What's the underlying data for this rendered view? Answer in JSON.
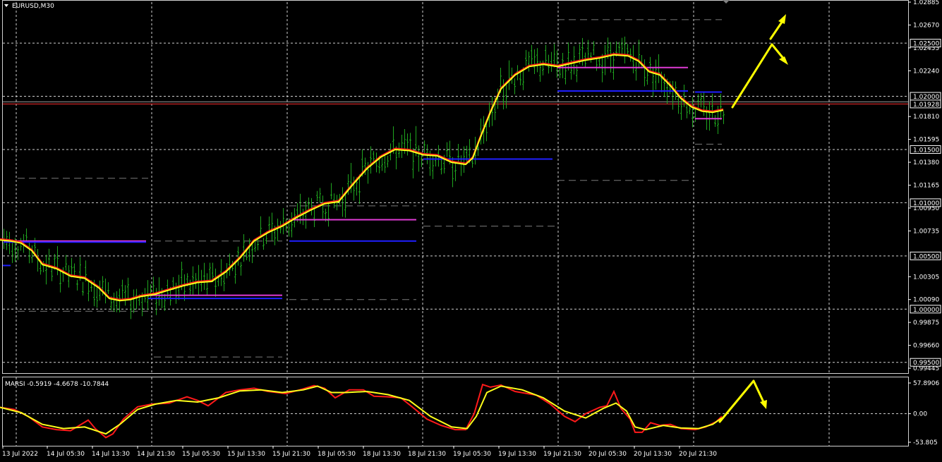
{
  "window": {
    "symbol_title": "EURUSD,M30",
    "indicator_title": "MARSI -0.5919 -4.6678 -10.7844"
  },
  "colors": {
    "background": "#000000",
    "grid": "#cfcfcf",
    "candles": "#1fa51f",
    "ma_red": "#ff1a1a",
    "ma_yellow": "#ffff1a",
    "level_magenta": "#e03bd6",
    "level_blue": "#1f1fff",
    "level_dashed": "#7a7a7a",
    "arrow": "#ffff00",
    "price_line": "#ff3030"
  },
  "chart_data": [
    {
      "type": "candlestick",
      "title": "EURUSD,M30",
      "ylim": [
        0.99445,
        1.02885
      ],
      "y_tick_labels": [
        "1.02885",
        "1.02670",
        "1.02455",
        "1.02240",
        "1.01810",
        "1.01595",
        "1.01380",
        "1.01165",
        "1.00950",
        "1.00735",
        "1.00305",
        "1.00090",
        "0.99875",
        "0.99660",
        "0.99445"
      ],
      "highlighted_levels": [
        "1.02500",
        "1.02000",
        "1.01928",
        "1.01500",
        "1.01000",
        "1.00500",
        "1.00000",
        "0.99500"
      ],
      "current_price": "1.01928",
      "x_tick_labels": [
        "13 Jul 2022",
        "14 Jul 05:30",
        "14 Jul 13:30",
        "14 Jul 21:30",
        "15 Jul 05:30",
        "15 Jul 13:30",
        "15 Jul 21:30",
        "18 Jul 05:30",
        "18 Jul 13:30",
        "18 Jul 21:30",
        "19 Jul 05:30",
        "19 Jul 13:30",
        "19 Jul 21:30",
        "20 Jul 05:30",
        "20 Jul 13:30",
        "20 Jul 21:30"
      ],
      "price_path": [
        [
          0,
          1.0065
        ],
        [
          15,
          1.0064
        ],
        [
          30,
          1.0062
        ],
        [
          45,
          1.0055
        ],
        [
          60,
          1.0042
        ],
        [
          80,
          1.0038
        ],
        [
          100,
          1.0031
        ],
        [
          120,
          1.0029
        ],
        [
          140,
          1.002
        ],
        [
          155,
          1.001
        ],
        [
          170,
          1.0008
        ],
        [
          185,
          1.0009
        ],
        [
          200,
          1.0012
        ],
        [
          220,
          1.0014
        ],
        [
          240,
          1.0018
        ],
        [
          260,
          1.0022
        ],
        [
          280,
          1.0025
        ],
        [
          300,
          1.0026
        ],
        [
          320,
          1.0035
        ],
        [
          340,
          1.0048
        ],
        [
          360,
          1.0064
        ],
        [
          380,
          1.0072
        ],
        [
          400,
          1.0078
        ],
        [
          420,
          1.0086
        ],
        [
          440,
          1.0093
        ],
        [
          460,
          1.0099
        ],
        [
          480,
          1.0101
        ],
        [
          500,
          1.0117
        ],
        [
          520,
          1.0132
        ],
        [
          540,
          1.0143
        ],
        [
          560,
          1.015
        ],
        [
          580,
          1.0149
        ],
        [
          600,
          1.0145
        ],
        [
          620,
          1.0144
        ],
        [
          640,
          1.0138
        ],
        [
          660,
          1.0136
        ],
        [
          670,
          1.0142
        ],
        [
          680,
          1.016
        ],
        [
          695,
          1.0185
        ],
        [
          710,
          1.0207
        ],
        [
          730,
          1.022
        ],
        [
          750,
          1.0228
        ],
        [
          770,
          1.023
        ],
        [
          790,
          1.0228
        ],
        [
          810,
          1.0231
        ],
        [
          830,
          1.0234
        ],
        [
          850,
          1.0236
        ],
        [
          870,
          1.0239
        ],
        [
          890,
          1.0238
        ],
        [
          905,
          1.0233
        ],
        [
          920,
          1.0223
        ],
        [
          935,
          1.022
        ],
        [
          950,
          1.021
        ],
        [
          965,
          1.0198
        ],
        [
          980,
          1.019
        ],
        [
          995,
          1.0186
        ],
        [
          1010,
          1.0185
        ],
        [
          1025,
          1.0187
        ]
      ],
      "levels": [
        {
          "color": "level_magenta",
          "y": 1.0064,
          "x": [
            5,
            207
          ]
        },
        {
          "color": "level_blue",
          "y": 1.0063,
          "x": [
            5,
            207
          ]
        },
        {
          "color": "level_magenta",
          "y": 1.0013,
          "x": [
            210,
            400
          ]
        },
        {
          "color": "level_blue",
          "y": 1.001,
          "x": [
            210,
            400
          ]
        },
        {
          "color": "level_magenta",
          "y": 1.0084,
          "x": [
            410,
            590
          ]
        },
        {
          "color": "level_blue",
          "y": 1.0064,
          "x": [
            410,
            590
          ]
        },
        {
          "color": "level_blue",
          "y": 1.0141,
          "x": [
            600,
            783
          ]
        },
        {
          "color": "level_magenta",
          "y": 1.0227,
          "x": [
            790,
            975
          ]
        },
        {
          "color": "level_blue",
          "y": 1.0205,
          "x": [
            790,
            975
          ]
        },
        {
          "color": "level_blue",
          "y": 1.0204,
          "x": [
            985,
            1023
          ]
        },
        {
          "color": "level_magenta",
          "y": 1.0179,
          "x": [
            985,
            1023
          ]
        }
      ],
      "dashed_levels": [
        {
          "y": 1.0123,
          "x": [
            25,
            210
          ]
        },
        {
          "y": 1.0064,
          "x": [
            218,
            400
          ]
        },
        {
          "y": 0.9998,
          "x": [
            25,
            210
          ]
        },
        {
          "y": 0.9955,
          "x": [
            218,
            400
          ]
        },
        {
          "y": 1.0097,
          "x": [
            410,
            590
          ]
        },
        {
          "y": 1.0009,
          "x": [
            410,
            590
          ]
        },
        {
          "y": 1.0078,
          "x": [
            600,
            790
          ]
        },
        {
          "y": 1.0272,
          "x": [
            790,
            1023
          ]
        },
        {
          "y": 1.0121,
          "x": [
            790,
            980
          ]
        },
        {
          "y": 1.0155,
          "x": [
            985,
            1023
          ]
        }
      ]
    },
    {
      "type": "line",
      "title": "MARSI -0.5919 -4.6678 -10.7844",
      "ylim": [
        -53.805,
        57.8906
      ],
      "y_tick_labels": [
        "57.8906",
        "0.00",
        "-53.805"
      ],
      "series": [
        {
          "color": "ma_red",
          "points": [
            [
              0,
              12
            ],
            [
              20,
              8
            ],
            [
              40,
              -5
            ],
            [
              60,
              -25
            ],
            [
              80,
              -30
            ],
            [
              100,
              -32
            ],
            [
              115,
              -20
            ],
            [
              125,
              -12
            ],
            [
              135,
              -28
            ],
            [
              150,
              -45
            ],
            [
              160,
              -38
            ],
            [
              175,
              -10
            ],
            [
              195,
              13
            ],
            [
              215,
              18
            ],
            [
              240,
              20
            ],
            [
              265,
              32
            ],
            [
              280,
              25
            ],
            [
              295,
              15
            ],
            [
              320,
              40
            ],
            [
              340,
              45
            ],
            [
              360,
              48
            ],
            [
              380,
              42
            ],
            [
              405,
              38
            ],
            [
              425,
              45
            ],
            [
              445,
              53
            ],
            [
              460,
              48
            ],
            [
              475,
              30
            ],
            [
              495,
              45
            ],
            [
              515,
              45
            ],
            [
              530,
              33
            ],
            [
              548,
              32
            ],
            [
              568,
              30
            ],
            [
              585,
              12
            ],
            [
              605,
              -10
            ],
            [
              625,
              -22
            ],
            [
              645,
              -30
            ],
            [
              660,
              -30
            ],
            [
              672,
              0
            ],
            [
              684,
              55
            ],
            [
              695,
              50
            ],
            [
              710,
              54
            ],
            [
              730,
              42
            ],
            [
              760,
              35
            ],
            [
              780,
              18
            ],
            [
              800,
              -5
            ],
            [
              815,
              -15
            ],
            [
              830,
              0
            ],
            [
              850,
              12
            ],
            [
              860,
              15
            ],
            [
              870,
              42
            ],
            [
              880,
              10
            ],
            [
              893,
              -10
            ],
            [
              900,
              -35
            ],
            [
              910,
              -35
            ],
            [
              922,
              -17
            ],
            [
              935,
              -22
            ],
            [
              950,
              -20
            ],
            [
              965,
              -28
            ],
            [
              985,
              -30
            ],
            [
              1000,
              -25
            ],
            [
              1015,
              -15
            ],
            [
              1023,
              -5
            ]
          ]
        },
        {
          "color": "ma_yellow",
          "points": [
            [
              0,
              12
            ],
            [
              30,
              2
            ],
            [
              60,
              -20
            ],
            [
              90,
              -28
            ],
            [
              120,
              -25
            ],
            [
              150,
              -38
            ],
            [
              170,
              -20
            ],
            [
              195,
              8
            ],
            [
              220,
              18
            ],
            [
              250,
              25
            ],
            [
              280,
              22
            ],
            [
              310,
              30
            ],
            [
              340,
              43
            ],
            [
              370,
              45
            ],
            [
              400,
              40
            ],
            [
              430,
              45
            ],
            [
              450,
              52
            ],
            [
              470,
              40
            ],
            [
              490,
              40
            ],
            [
              520,
              42
            ],
            [
              550,
              36
            ],
            [
              580,
              25
            ],
            [
              610,
              -5
            ],
            [
              640,
              -25
            ],
            [
              662,
              -28
            ],
            [
              675,
              -5
            ],
            [
              690,
              40
            ],
            [
              710,
              52
            ],
            [
              740,
              45
            ],
            [
              770,
              30
            ],
            [
              800,
              5
            ],
            [
              830,
              -8
            ],
            [
              855,
              10
            ],
            [
              873,
              20
            ],
            [
              888,
              5
            ],
            [
              900,
              -25
            ],
            [
              915,
              -30
            ],
            [
              940,
              -22
            ],
            [
              965,
              -27
            ],
            [
              990,
              -28
            ],
            [
              1010,
              -20
            ],
            [
              1023,
              -8
            ]
          ]
        }
      ]
    }
  ]
}
